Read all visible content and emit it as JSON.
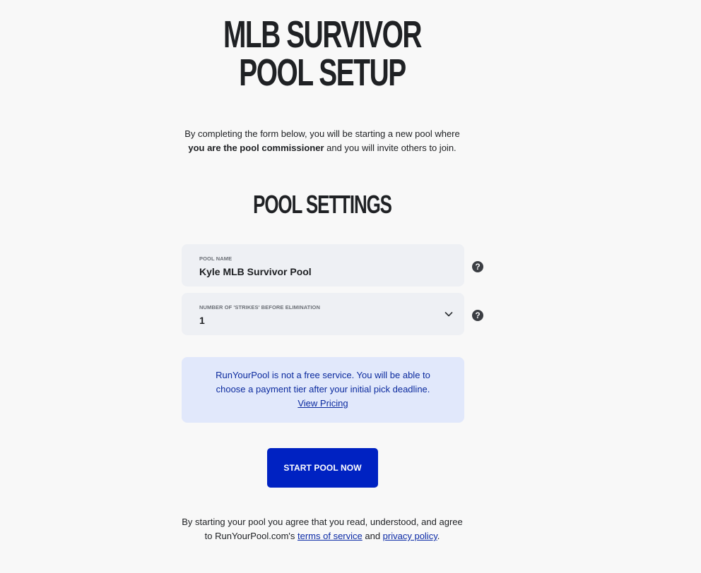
{
  "header": {
    "title_line1": "MLB SURVIVOR",
    "title_line2": "POOL SETUP"
  },
  "intro": {
    "text_before": "By completing the form below, you will be starting a new pool where ",
    "bold": "you are the pool commissioner",
    "text_after": " and you will invite others to join."
  },
  "settings": {
    "title": "POOL SETTINGS",
    "pool_name": {
      "label": "POOL NAME",
      "value": "Kyle MLB Survivor Pool",
      "help_icon": "question-circle-icon"
    },
    "strikes": {
      "label": "NUMBER OF 'STRIKES' BEFORE ELIMINATION",
      "selected": "1",
      "dropdown_icon": "chevron-down-icon",
      "help_icon": "question-circle-icon"
    }
  },
  "notice": {
    "line1": "RunYourPool is not a free service. You will be able to",
    "line2": "choose a payment tier after your initial pick deadline.",
    "link": "View Pricing"
  },
  "actions": {
    "start_label": "START POOL NOW"
  },
  "footer": {
    "line1": "By starting your pool you agree that you read, understood, and agree",
    "prefix": "to RunYourPool.com's ",
    "terms_link": "terms of service",
    "conjunction": " and ",
    "privacy_link": "privacy policy",
    "suffix": "."
  },
  "colors": {
    "background": "#f8f8f8",
    "primary": "#0022c2",
    "notice_bg": "#e1e8fb",
    "notice_text": "#0b2a9e",
    "field_bg": "#eef0f4"
  }
}
